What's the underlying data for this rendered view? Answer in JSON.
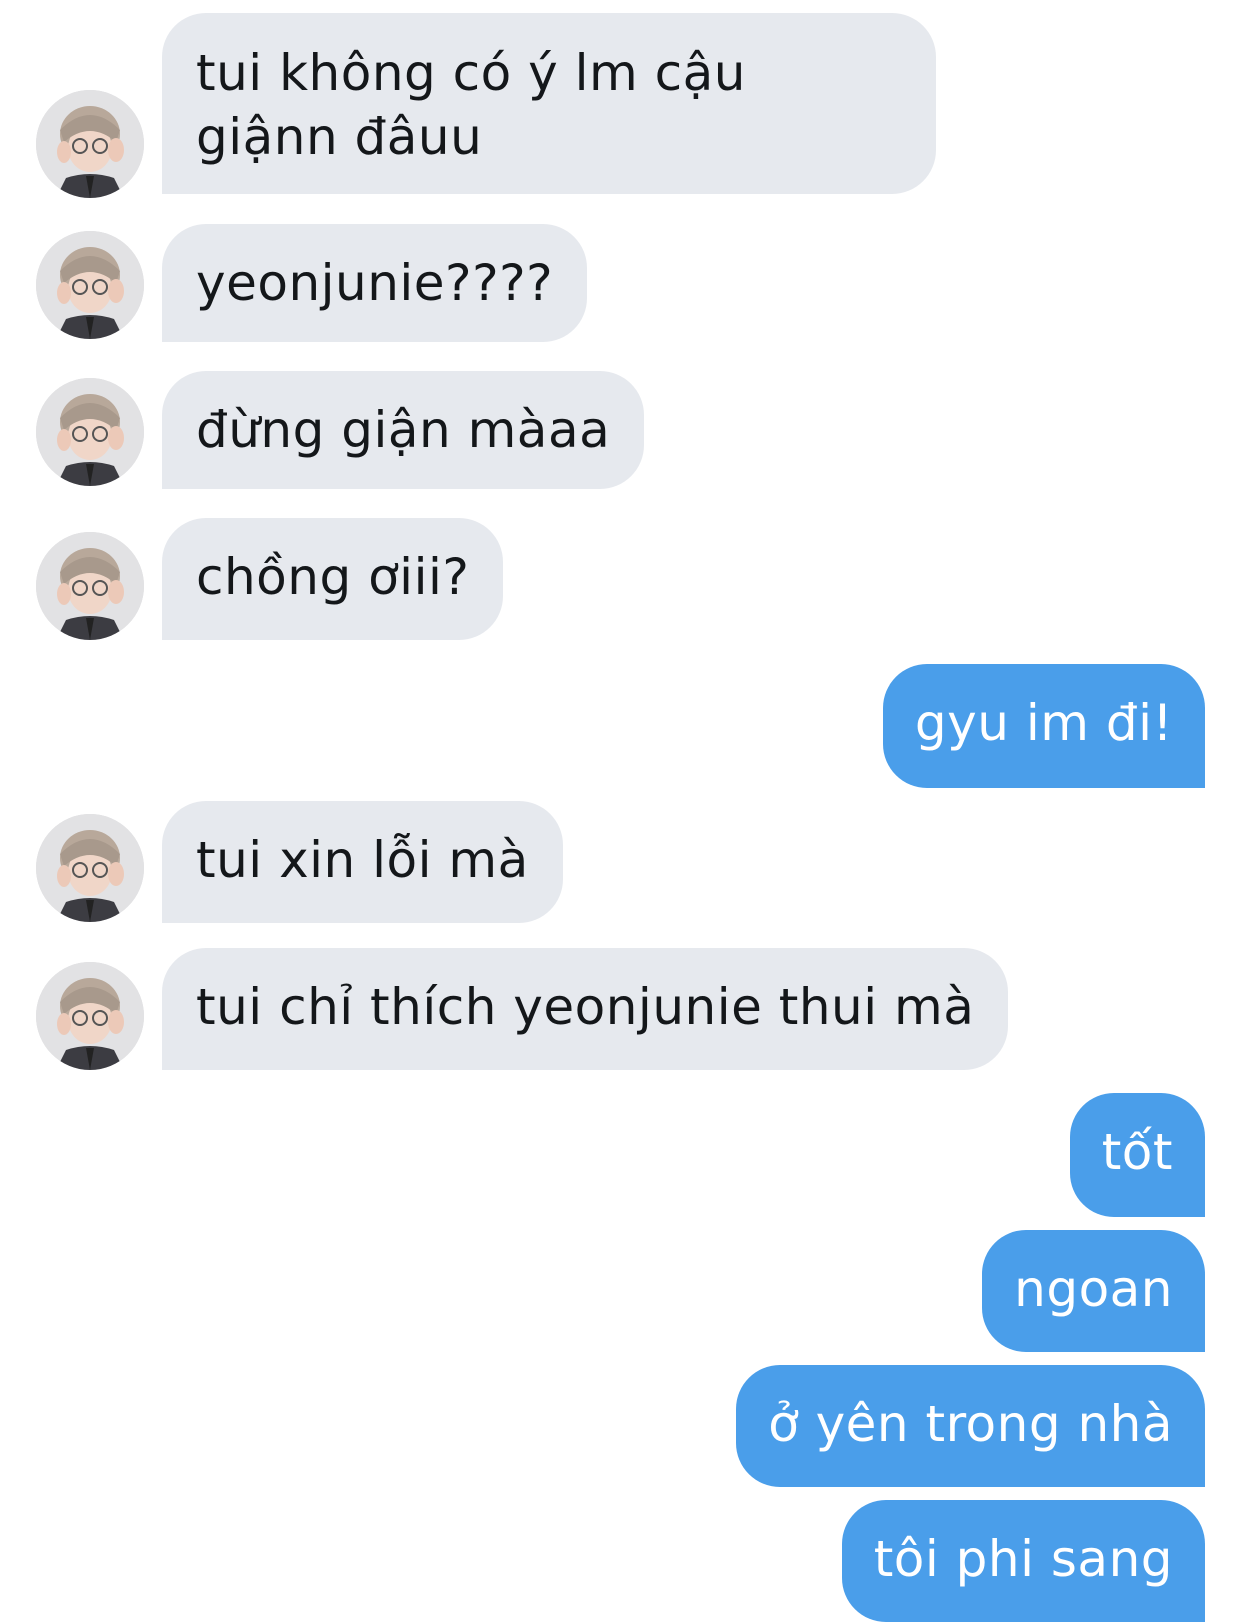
{
  "conversation": {
    "messages": [
      {
        "direction": "incoming",
        "text": "tui không có ý lm cậu giậnn đâuu"
      },
      {
        "direction": "incoming",
        "text": "yeonjunie????"
      },
      {
        "direction": "incoming",
        "text": "đừng giận màaa"
      },
      {
        "direction": "incoming",
        "text": "chồng ơiii?"
      },
      {
        "direction": "outgoing",
        "text": "gyu im đi!"
      },
      {
        "direction": "incoming",
        "text": "tui xin lỗi mà"
      },
      {
        "direction": "incoming",
        "text": "tui chỉ thích yeonjunie thui mà"
      },
      {
        "direction": "outgoing",
        "text": "tốt"
      },
      {
        "direction": "outgoing",
        "text": "ngoan"
      },
      {
        "direction": "outgoing",
        "text": "ở yên trong nhà"
      },
      {
        "direction": "outgoing",
        "text": "tôi phi sang"
      }
    ]
  },
  "colors": {
    "incoming_bubble": "#e6e9ee",
    "outgoing_bubble": "#4a9eea",
    "incoming_text": "#14171a",
    "outgoing_text": "#ffffff"
  },
  "icons": {
    "sender_avatar": "avatar-photo"
  }
}
